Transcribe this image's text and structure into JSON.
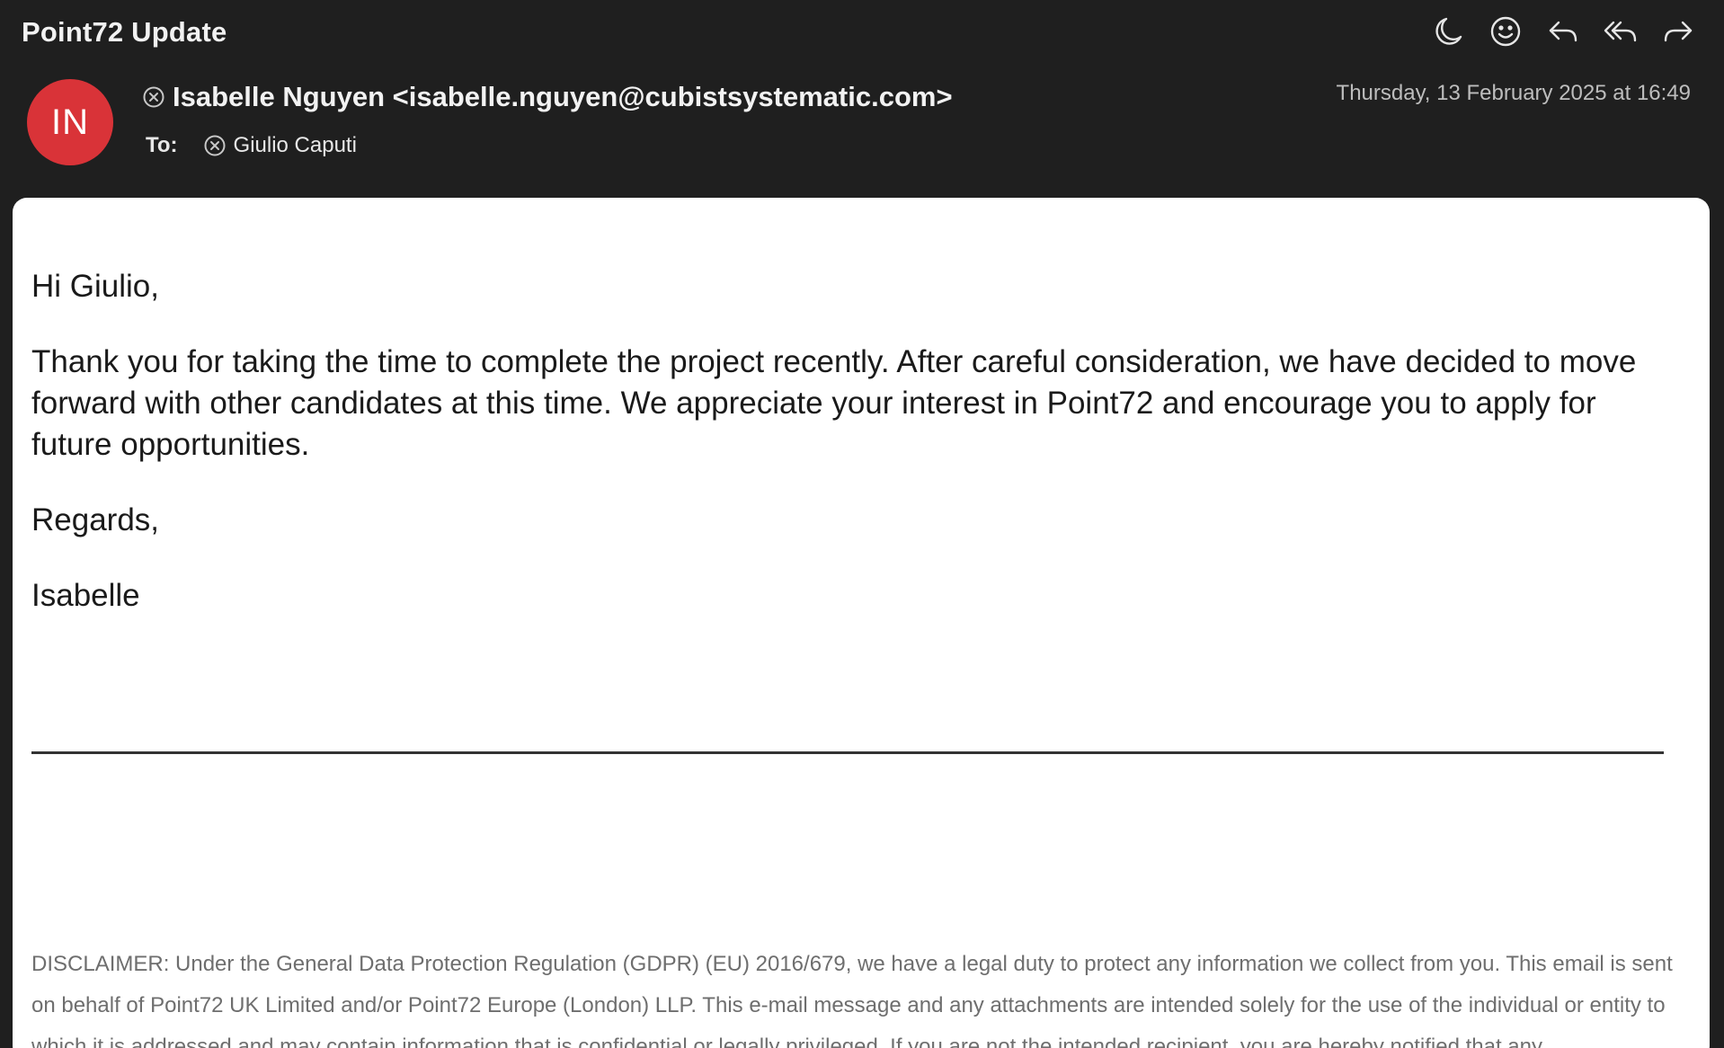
{
  "email": {
    "subject": "Point72 Update",
    "sender": {
      "initials": "IN",
      "display": "Isabelle Nguyen <isabelle.nguyen@cubistsystematic.com>",
      "avatar_color": "#d93338"
    },
    "to_label": "To:",
    "recipient": "Giulio Caputi",
    "date": "Thursday, 13 February 2025 at 16:49",
    "body": {
      "greeting": "Hi Giulio,",
      "paragraph": "Thank you for taking the time to complete the project recently. After careful consideration, we have decided to move forward with other candidates at this time. We appreciate your interest in Point72 and encourage you to apply for future opportunities.",
      "closing": "Regards,",
      "signature": "Isabelle"
    },
    "disclaimer": "DISCLAIMER: Under the General Data Protection Regulation (GDPR) (EU) 2016/679, we have a legal duty to protect any information we collect from you. This email is sent on behalf of Point72 UK Limited and/or Point72 Europe (London) LLP. This e-mail message and any attachments are intended solely for the use of the individual or entity to which it is addressed and may contain information that is confidential or legally privileged. If you are not the intended recipient, you are hereby notified that any"
  },
  "toolbar": {
    "icons": [
      "moon-icon",
      "smiley-icon",
      "reply-icon",
      "reply-all-icon",
      "forward-icon"
    ]
  },
  "theme": {
    "header_bg": "#1f1f1f",
    "card_bg": "#ffffff",
    "icon_color": "#e6e6e6"
  }
}
